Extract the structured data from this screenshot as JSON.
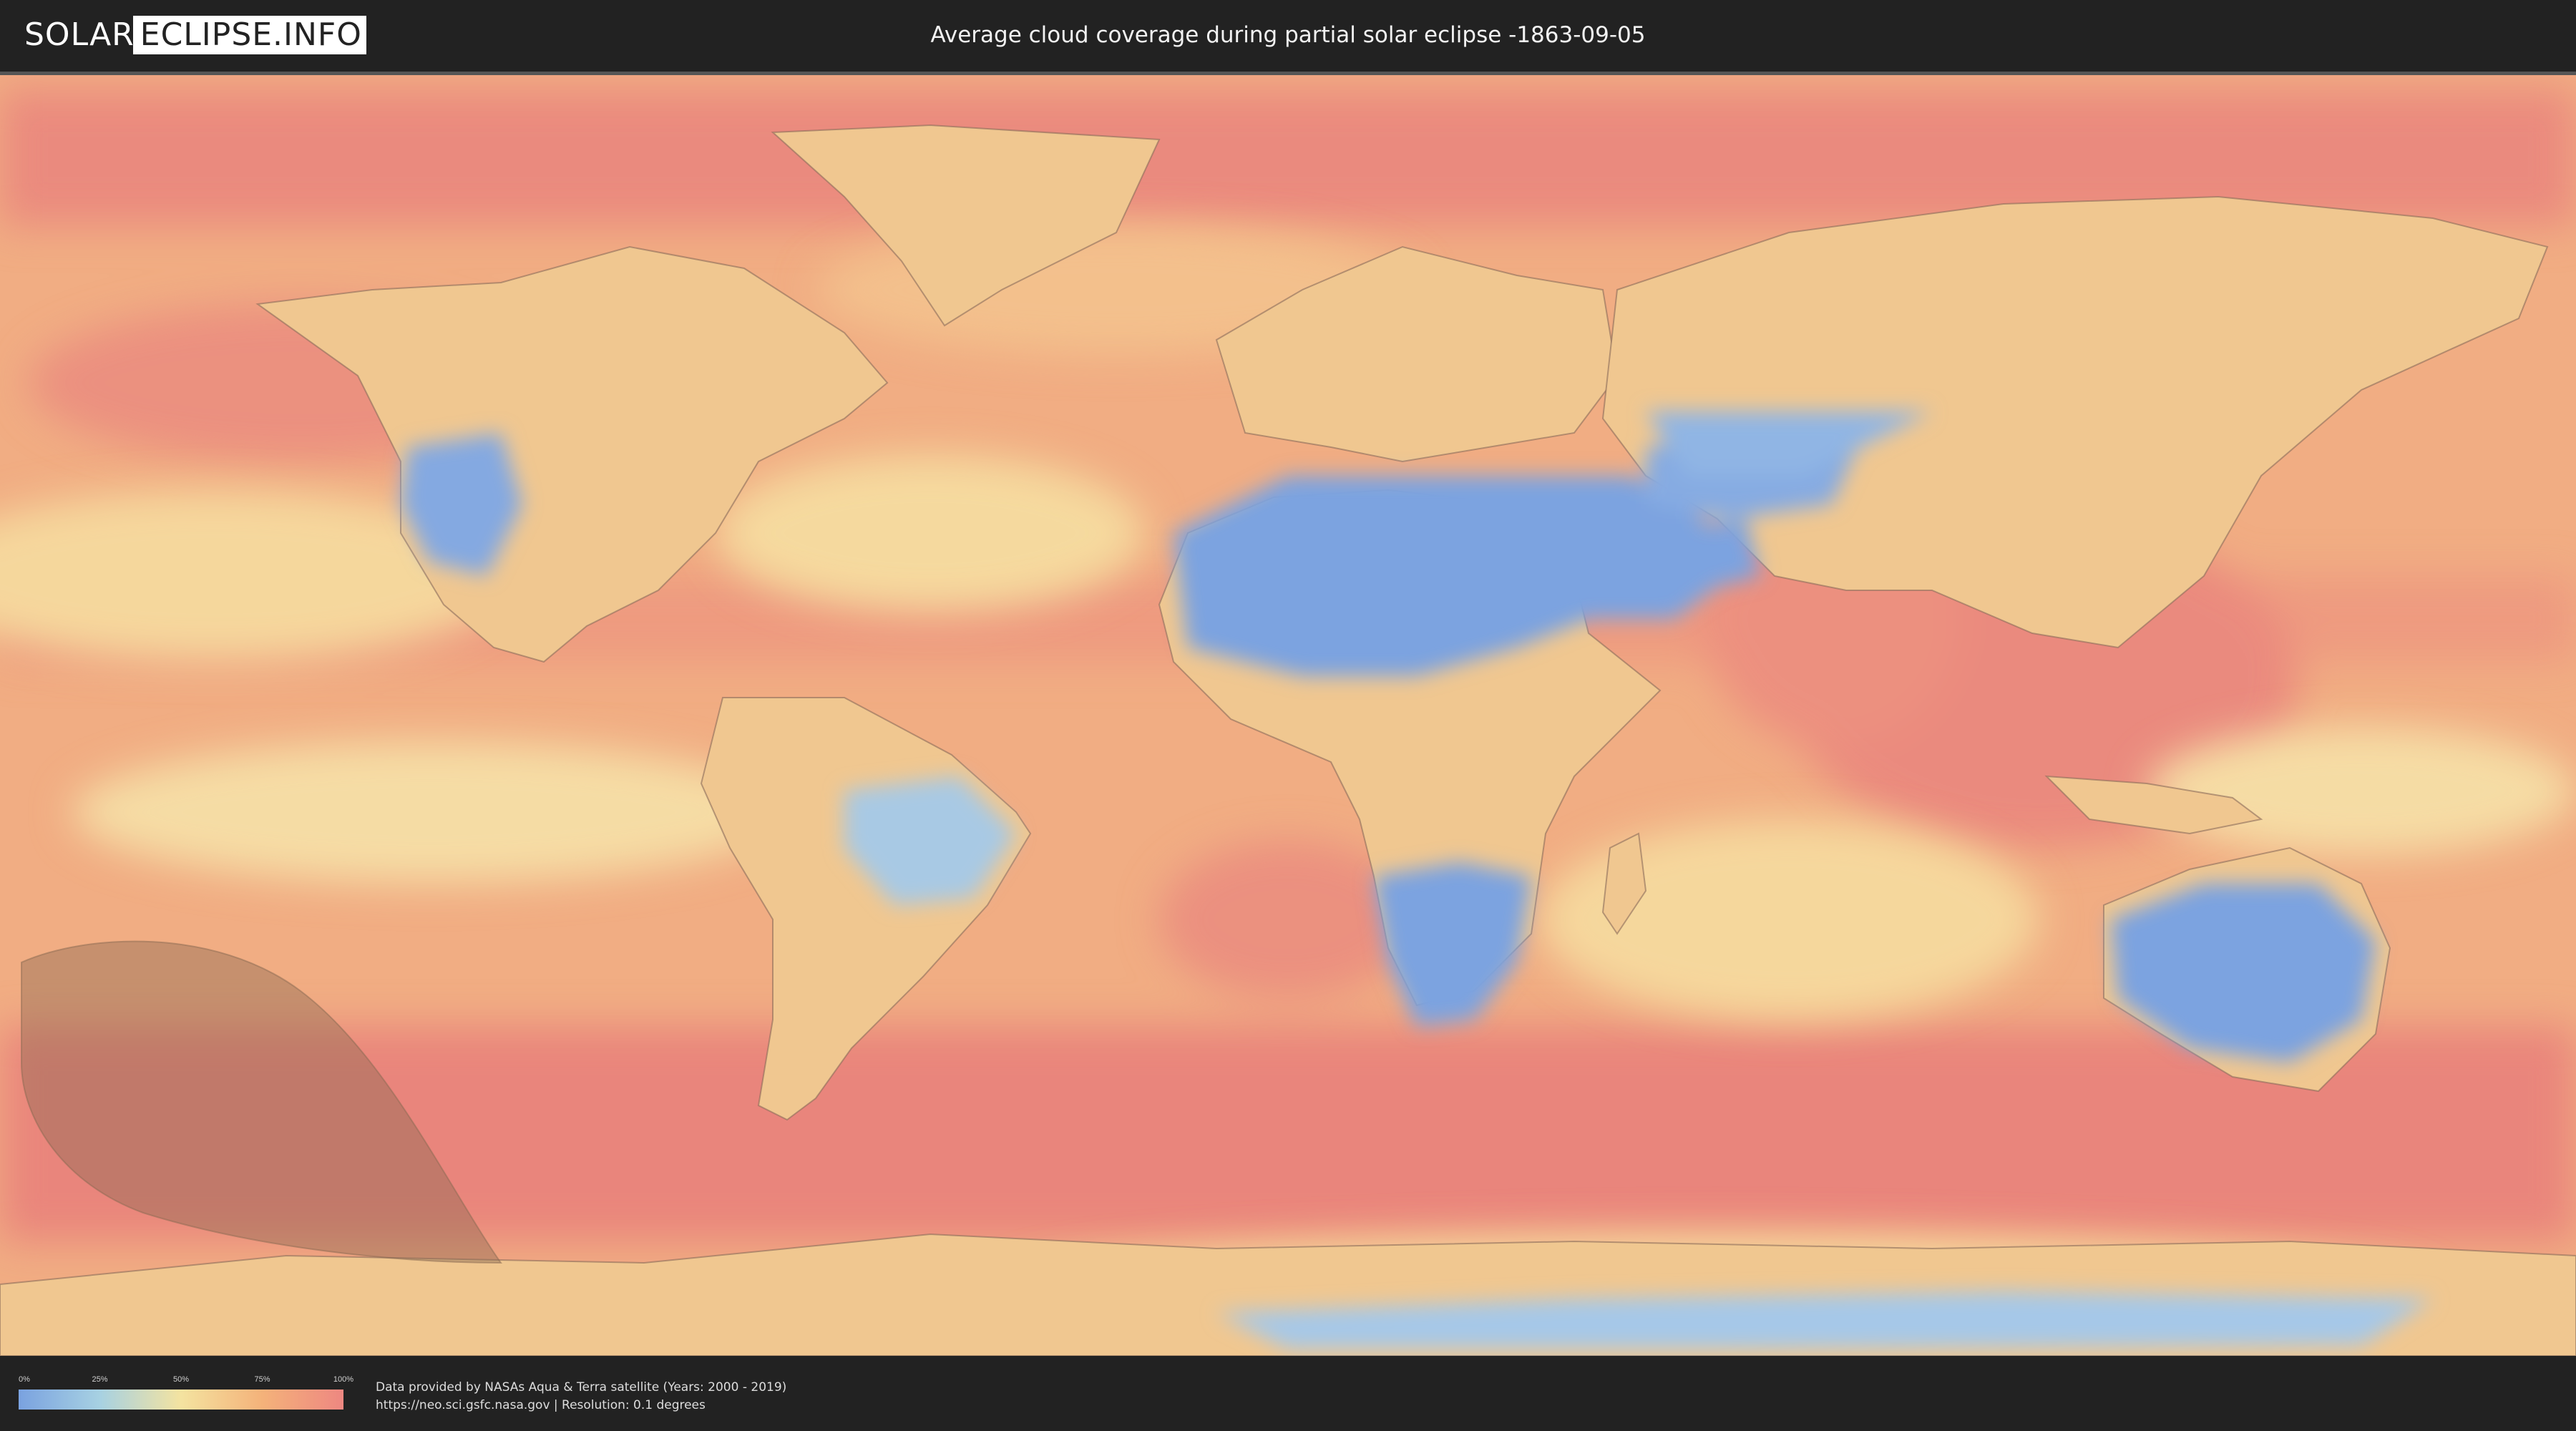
{
  "header": {
    "logo_part1": "SOLAR",
    "logo_part2": "ECLIPSE.INFO",
    "title": "Average cloud coverage during partial solar eclipse -1863-09-05"
  },
  "legend": {
    "ticks": [
      "0%",
      "25%",
      "50%",
      "75%",
      "100%"
    ],
    "colors": [
      "#7aa2e0",
      "#a7d1e2",
      "#f4e3a0",
      "#f4b27a",
      "#ee8781"
    ]
  },
  "footer": {
    "credit_line1": "Data provided by NASAs Aqua & Terra satellite (Years: 2000 - 2019)",
    "credit_line2": "https://neo.sci.gsfc.nasa.gov | Resolution: 0.1 degrees"
  },
  "map": {
    "layer": "average cloud coverage",
    "projection": "equirectangular",
    "colors": {
      "ocean": "#f1ad83",
      "clear_sky": "#7aa2e0",
      "cloudy": "#e9877d",
      "borders": "#8a6a5a",
      "eclipse_zone": "#9b7a5e"
    }
  }
}
